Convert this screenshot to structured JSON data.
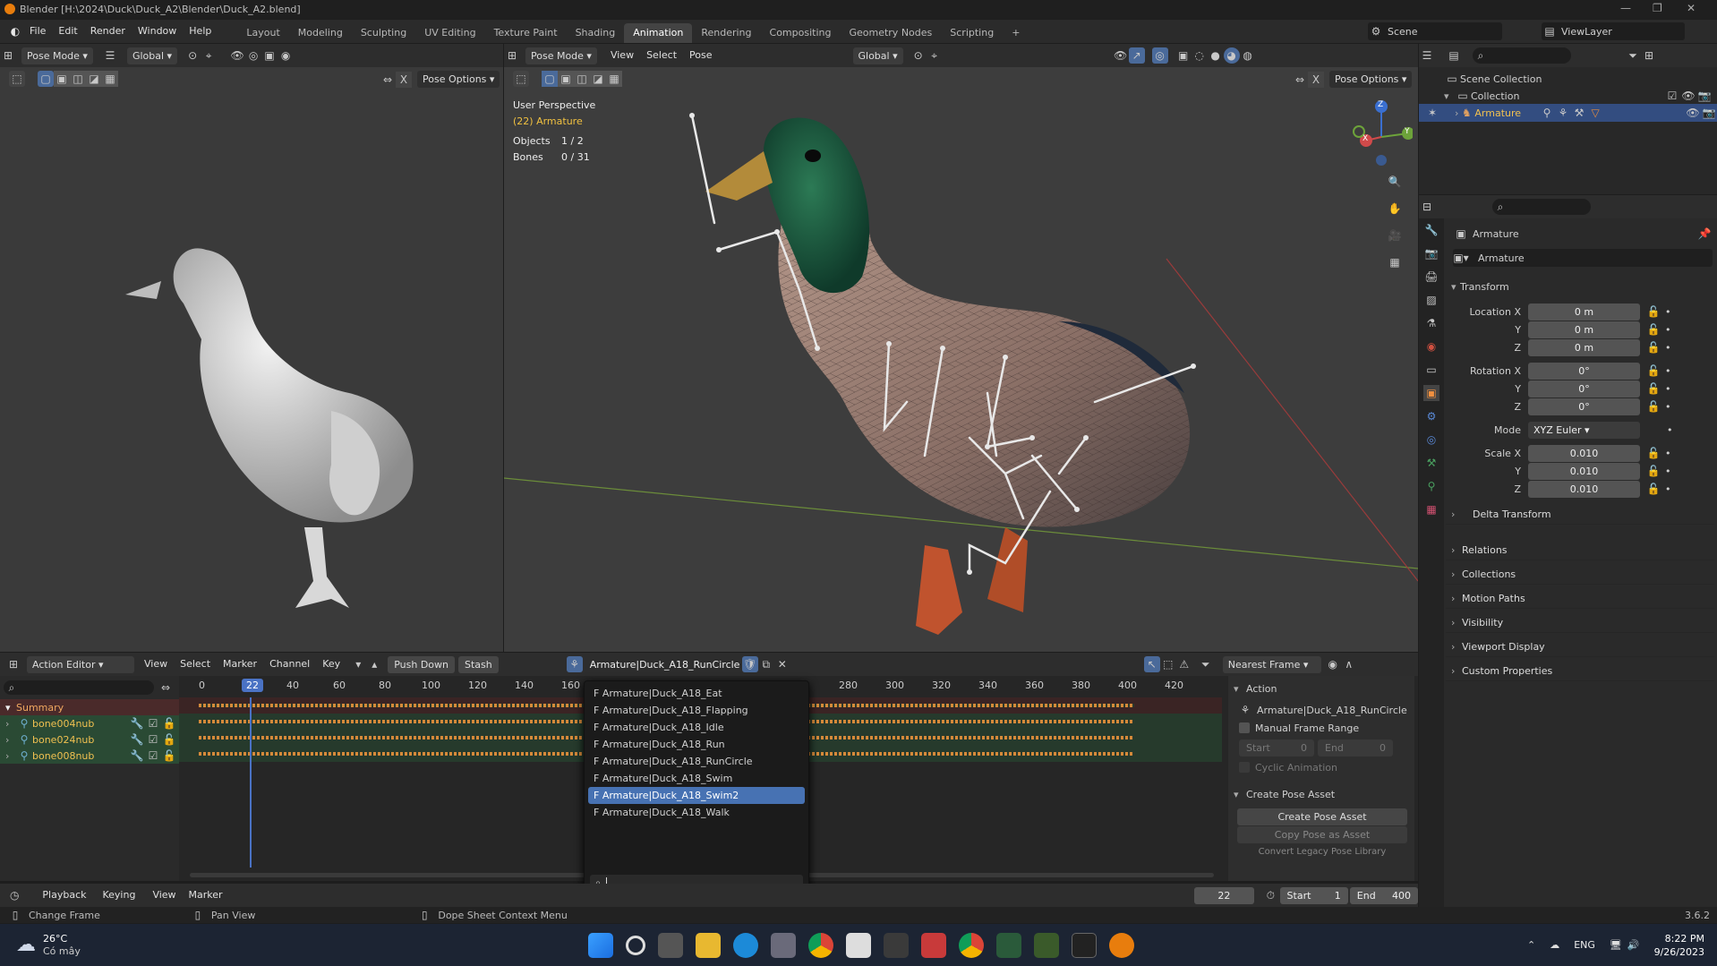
{
  "window": {
    "title": "Blender [H:\\2024\\Duck\\Duck_A2\\Blender\\Duck_A2.blend]"
  },
  "menubar": {
    "items": [
      "File",
      "Edit",
      "Render",
      "Window",
      "Help"
    ],
    "workspaces": [
      "Layout",
      "Modeling",
      "Sculpting",
      "UV Editing",
      "Texture Paint",
      "Shading",
      "Animation",
      "Rendering",
      "Compositing",
      "Geometry Nodes",
      "Scripting"
    ],
    "active_workspace": "Animation",
    "scene": "Scene",
    "view_layer": "ViewLayer"
  },
  "viewport_left": {
    "mode": "Pose Mode",
    "orientation": "Global",
    "pose_options": "Pose Options"
  },
  "viewport_main": {
    "mode": "Pose Mode",
    "menus": [
      "View",
      "Select",
      "Pose"
    ],
    "orientation": "Global",
    "pose_options": "Pose Options",
    "overlay": {
      "perspective": "User Perspective",
      "object": "(22) Armature",
      "objects_label": "Objects",
      "objects_value": "1 / 2",
      "bones_label": "Bones",
      "bones_value": "0 / 31"
    },
    "gizmo": {
      "x": "X",
      "y": "Y",
      "z": "Z"
    }
  },
  "outliner": {
    "scene_collection": "Scene Collection",
    "collection": "Collection",
    "armature": "Armature"
  },
  "properties": {
    "object_name": "Armature",
    "data_name": "Armature",
    "transform_label": "Transform",
    "location_label": "Location X",
    "loc": [
      "0 m",
      "0 m",
      "0 m"
    ],
    "rotation_label": "Rotation X",
    "rot": [
      "0°",
      "0°",
      "0°"
    ],
    "mode_label": "Mode",
    "mode_value": "XYZ Euler",
    "scale_label": "Scale X",
    "scale": [
      "0.010",
      "0.010",
      "0.010"
    ],
    "y": "Y",
    "z": "Z",
    "sections": [
      "Delta Transform",
      "Relations",
      "Collections",
      "Motion Paths",
      "Visibility",
      "Viewport Display",
      "Custom Properties"
    ]
  },
  "action_editor": {
    "mode": "Action Editor",
    "menus": [
      "View",
      "Select",
      "Marker",
      "Channel",
      "Key"
    ],
    "push_down": "Push Down",
    "stash": "Stash",
    "action": "Armature|Duck_A18_RunCircle",
    "snap": "Nearest Frame",
    "channels": [
      "Summary",
      "bone004nub",
      "bone024nub",
      "bone008nub"
    ],
    "frame_numbers": [
      "0",
      "22",
      "40",
      "60",
      "80",
      "100",
      "120",
      "140",
      "160",
      "280",
      "300",
      "320",
      "340",
      "360",
      "380",
      "400",
      "420"
    ],
    "current_frame": "22",
    "dropdown": [
      "F Armature|Duck_A18_Eat",
      "F Armature|Duck_A18_Flapping",
      "F Armature|Duck_A18_Idle",
      "F Armature|Duck_A18_Run",
      "F Armature|Duck_A18_RunCircle",
      "F Armature|Duck_A18_Swim",
      "F Armature|Duck_A18_Swim2",
      "F Armature|Duck_A18_Walk"
    ],
    "dropdown_selected": "F Armature|Duck_A18_Swim2",
    "side": {
      "action_label": "Action",
      "action_name": "Armature|Duck_A18_RunCircle",
      "manual_range": "Manual Frame Range",
      "start_label": "Start",
      "start_val": "0",
      "end_label": "End",
      "end_val": "0",
      "cyclic": "Cyclic Animation",
      "pose_asset_label": "Create Pose Asset",
      "create_pose": "Create Pose Asset",
      "copy_pose": "Copy Pose as Asset",
      "convert": "Convert Legacy Pose Library"
    }
  },
  "timeline": {
    "menus": [
      "Playback",
      "Keying",
      "View",
      "Marker"
    ],
    "frame": "22",
    "start_label": "Start",
    "start": "1",
    "end_label": "End",
    "end": "400"
  },
  "statusbar": {
    "left": "Change Frame",
    "mid": "Pan View",
    "right": "Dope Sheet Context Menu",
    "version": "3.6.2"
  },
  "taskbar": {
    "temp": "26°C",
    "weather": "Có mây",
    "lang": "ENG",
    "time": "8:22 PM",
    "date": "9/26/2023"
  }
}
